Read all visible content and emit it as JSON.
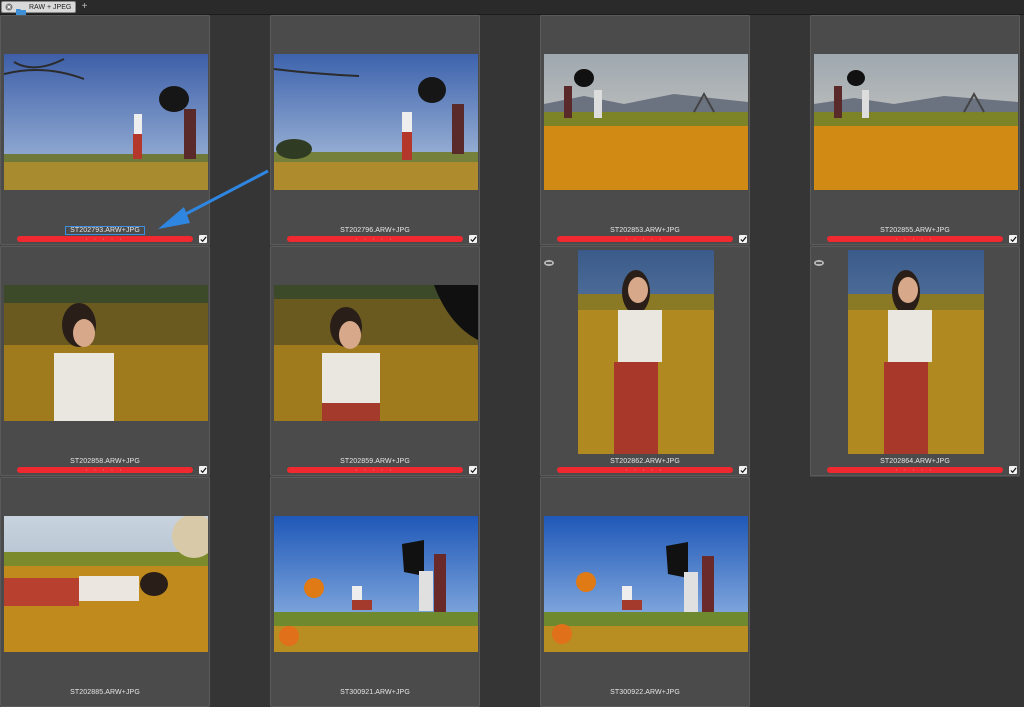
{
  "tab": {
    "label": "RAW + JPEG",
    "add_symbol": "+"
  },
  "thumbnails": [
    {
      "filename": "ST202793.ARW+JPG",
      "label_color": "#f0282f",
      "selected_name": true
    },
    {
      "filename": "ST202796.ARW+JPG",
      "label_color": "#f0282f"
    },
    {
      "filename": "ST202853.ARW+JPG",
      "label_color": "#f0282f"
    },
    {
      "filename": "ST202855.ARW+JPG",
      "label_color": "#f0282f"
    },
    {
      "filename": "ST202858.ARW+JPG",
      "label_color": "#f0282f"
    },
    {
      "filename": "ST202859.ARW+JPG",
      "label_color": "#f0282f"
    },
    {
      "filename": "ST202862.ARW+JPG",
      "label_color": "#f0282f"
    },
    {
      "filename": "ST202864.ARW+JPG",
      "label_color": "#f0282f"
    },
    {
      "filename": "ST202885.ARW+JPG"
    },
    {
      "filename": "ST300921.ARW+JPG"
    },
    {
      "filename": "ST300922.ARW+JPG"
    }
  ],
  "stars_text": "• • • • •"
}
